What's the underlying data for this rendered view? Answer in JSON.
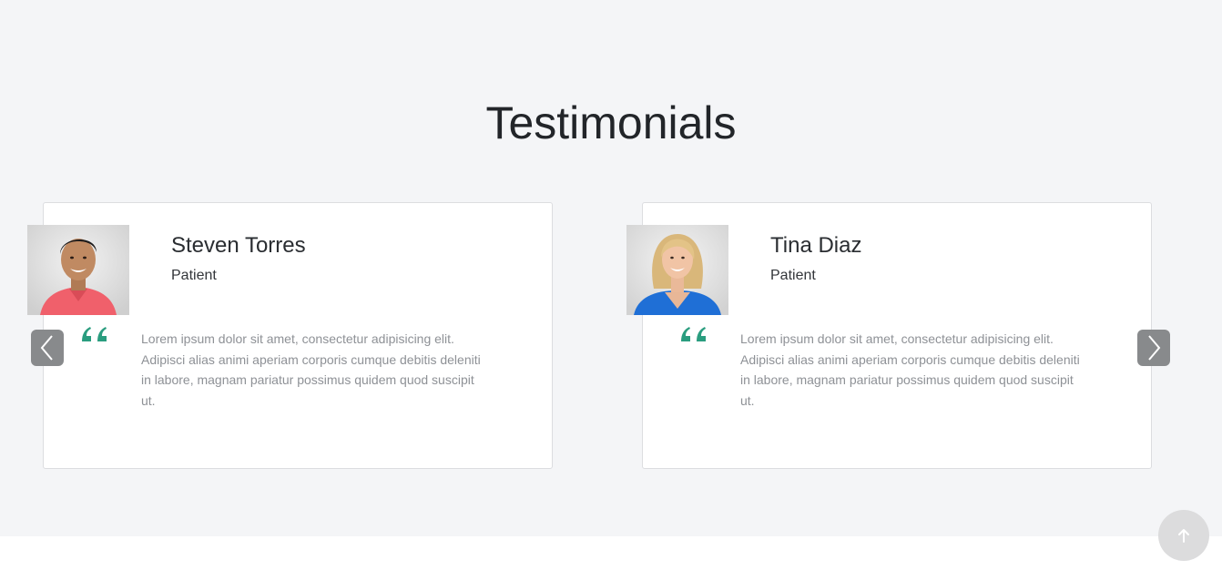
{
  "section": {
    "title": "Testimonials"
  },
  "testimonials": [
    {
      "name": "Steven Torres",
      "role": "Patient",
      "text": "Lorem ipsum dolor sit amet, consectetur adipisicing elit. Adipisci alias animi aperiam corporis cumque debitis deleniti in labore, magnam pariatur possimus quidem quod suscipit ut."
    },
    {
      "name": "Tina Diaz",
      "role": "Patient",
      "text": "Lorem ipsum dolor sit amet, consectetur adipisicing elit. Adipisci alias animi aperiam corporis cumque debitis deleniti in labore, magnam pariatur possimus quidem quod suscipit ut."
    }
  ],
  "icons": {
    "prev": "chevron-left-icon",
    "next": "chevron-right-icon",
    "quote": "quote-icon",
    "back_to_top": "arrow-up-icon"
  },
  "colors": {
    "accent": "#2a9d7f",
    "section_bg": "#f4f5f7",
    "nav_button": "#888a8c"
  }
}
